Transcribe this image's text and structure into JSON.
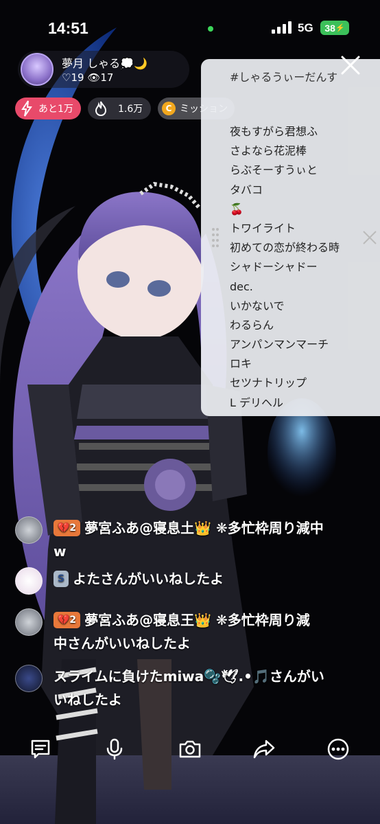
{
  "status_bar": {
    "time": "14:51",
    "network": "5G",
    "battery": "38"
  },
  "profile": {
    "name": "夢月 しゃる💭🌙",
    "likes": "♡19",
    "viewers": "👁17"
  },
  "chips": {
    "goal_label": "あと1万",
    "points_label": "1.6万",
    "mission_label": "ミッション"
  },
  "setlist": {
    "title": "#しゃるうぃーだんす",
    "songs": [
      "夜もすがら君想ふ",
      "さよなら花泥棒",
      "らぶそーすうぃと",
      "タバコ",
      "🍒",
      "トワイライト",
      "初めての恋が終わる時",
      "シャドーシャドー",
      "dec.",
      "いかないで",
      "わるらん",
      "アンパンマンマーチ",
      "ロキ",
      "セツナトリップ",
      "L デリヘル"
    ]
  },
  "comments": [
    {
      "badge": "💔2",
      "line1": "夢宮ふあ@寝息土👑 ❋多忙枠周り減中",
      "line2": "w"
    },
    {
      "badge": "S",
      "line1": "よたさんがいいねしたよ",
      "line2": ""
    },
    {
      "badge": "💔2",
      "line1": "夢宮ふあ@寝息王👑 ❋多忙枠周り減",
      "line2": "中さんがいいねしたよ"
    },
    {
      "badge": "",
      "line1": "スライムに負けたmiwa🫧🕊.•🎵さんがい",
      "line2": "いねしたよ"
    }
  ],
  "colors": {
    "goal_chip": "#e84a6a",
    "badge_heart": "#e8783a",
    "battery": "#3cc05a",
    "status_dot": "#3cd65a"
  },
  "icons": [
    "chat-icon",
    "mic-icon",
    "camera-icon",
    "share-icon",
    "more-icon"
  ]
}
